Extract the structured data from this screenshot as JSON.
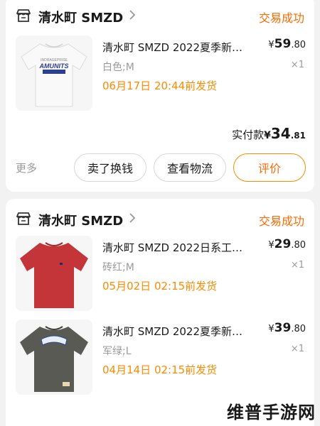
{
  "orders": [
    {
      "shop_name": "清水町 SMZD",
      "status": "交易成功",
      "items": [
        {
          "title": "清水町 SMZD 2022夏季新…",
          "price_currency": "¥",
          "price_int": "59",
          "price_dec": ".80",
          "spec": "白色;M",
          "qty": "×1",
          "ship_note": "06月17日 20:44前发货",
          "thumb_text": "AMUNITS",
          "thumb_color": "#f3f3f3"
        }
      ],
      "pay_label": "实付款",
      "pay_currency": "¥",
      "pay_int": "34",
      "pay_dec": ".81",
      "more_label": "更多",
      "buttons": {
        "sell": "卖了换钱",
        "logistics": "查看物流",
        "review": "评价"
      }
    },
    {
      "shop_name": "清水町 SMZD",
      "status": "交易成功",
      "items": [
        {
          "title": "清水町 SMZD 2022日系工…",
          "price_currency": "¥",
          "price_int": "29",
          "price_dec": ".80",
          "spec": "砖红;M",
          "qty": "×1",
          "ship_note": "05月02日 02:15前发货",
          "thumb_color": "#c4353a"
        },
        {
          "title": "清水町 SMZD 2022夏季新…",
          "price_currency": "¥",
          "price_int": "39",
          "price_dec": ".80",
          "spec": "军绿;L",
          "qty": "×1",
          "ship_note": "04月14日 02:15前发货",
          "thumb_color": "#5a5a55"
        }
      ]
    }
  ],
  "watermark": "维普手游网",
  "colors": {
    "accent": "#ff6a00",
    "ship_note": "#ff8a00",
    "muted": "#9a9a9a"
  }
}
